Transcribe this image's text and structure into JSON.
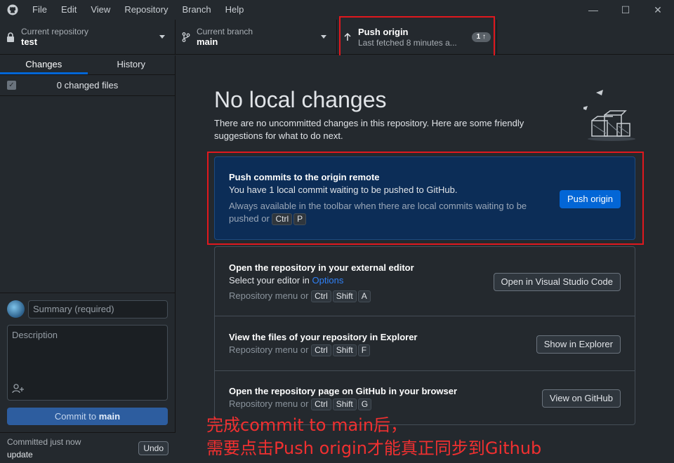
{
  "menu": [
    "File",
    "Edit",
    "View",
    "Repository",
    "Branch",
    "Help"
  ],
  "window_controls": {
    "minimize": "—",
    "maximize": "☐",
    "close": "✕"
  },
  "toolbar": {
    "repo_label": "Current repository",
    "repo_value": "test",
    "branch_label": "Current branch",
    "branch_value": "main",
    "push_title": "Push origin",
    "push_sub": "Last fetched 8 minutes a...",
    "push_badge": "1 ↑"
  },
  "sidebar": {
    "tab_changes": "Changes",
    "tab_history": "History",
    "changed_files": "0 changed files",
    "summary_placeholder": "Summary (required)",
    "description_placeholder": "Description",
    "commit_prefix": "Commit to",
    "commit_branch": "main",
    "last_commit_time": "Committed just now",
    "last_commit_msg": "update",
    "undo": "Undo"
  },
  "main": {
    "title": "No local changes",
    "subtitle": "There are no uncommitted changes in this repository. Here are some friendly suggestions for what to do next.",
    "push_card": {
      "title": "Push commits to the origin remote",
      "desc": "You have 1 local commit waiting to be pushed to GitHub.",
      "hint_line1": "Always available in the toolbar when there are local commits waiting to be",
      "hint_prefix": "pushed or",
      "keys": [
        "Ctrl",
        "P"
      ],
      "button": "Push origin"
    },
    "editor_card": {
      "title": "Open the repository in your external editor",
      "desc_prefix": "Select your editor in",
      "desc_link": "Options",
      "hint_prefix": "Repository menu or",
      "keys": [
        "Ctrl",
        "Shift",
        "A"
      ],
      "button": "Open in Visual Studio Code"
    },
    "explorer_card": {
      "title": "View the files of your repository in Explorer",
      "hint_prefix": "Repository menu or",
      "keys": [
        "Ctrl",
        "Shift",
        "F"
      ],
      "button": "Show in Explorer"
    },
    "github_card": {
      "title": "Open the repository page on GitHub in your browser",
      "hint_prefix": "Repository menu or",
      "keys": [
        "Ctrl",
        "Shift",
        "G"
      ],
      "button": "View on GitHub"
    }
  },
  "annotation": {
    "line1": "完成commit to main后，",
    "line2": "需要点击Push origin才能真正同步到Github"
  },
  "colors": {
    "accent": "#0366d6",
    "highlight_border": "#e0181e",
    "annotation": "#f03030"
  }
}
